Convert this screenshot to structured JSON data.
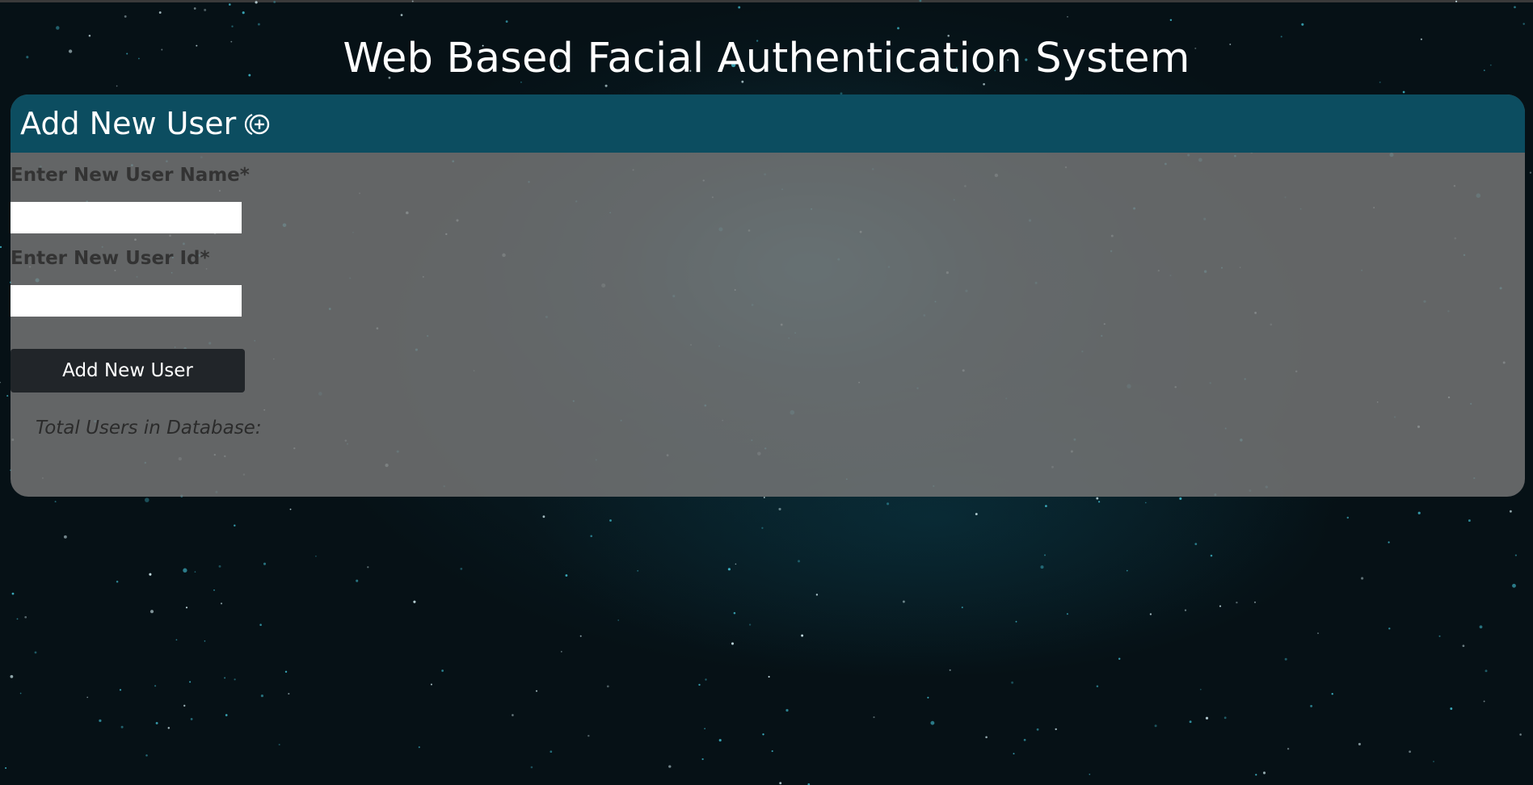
{
  "page": {
    "title": "Web Based Facial Authentication System"
  },
  "card": {
    "title": "Add New User",
    "icon": "add-circle-icon",
    "header_color": "#0c4d60"
  },
  "form": {
    "name_label": "Enter New User Name*",
    "name_value": "",
    "id_label": "Enter New User Id*",
    "id_value": "",
    "submit_label": "Add New User"
  },
  "stats": {
    "total_users_label": "Total Users in Database:"
  },
  "colors": {
    "background": "#061116",
    "button": "#212529"
  }
}
